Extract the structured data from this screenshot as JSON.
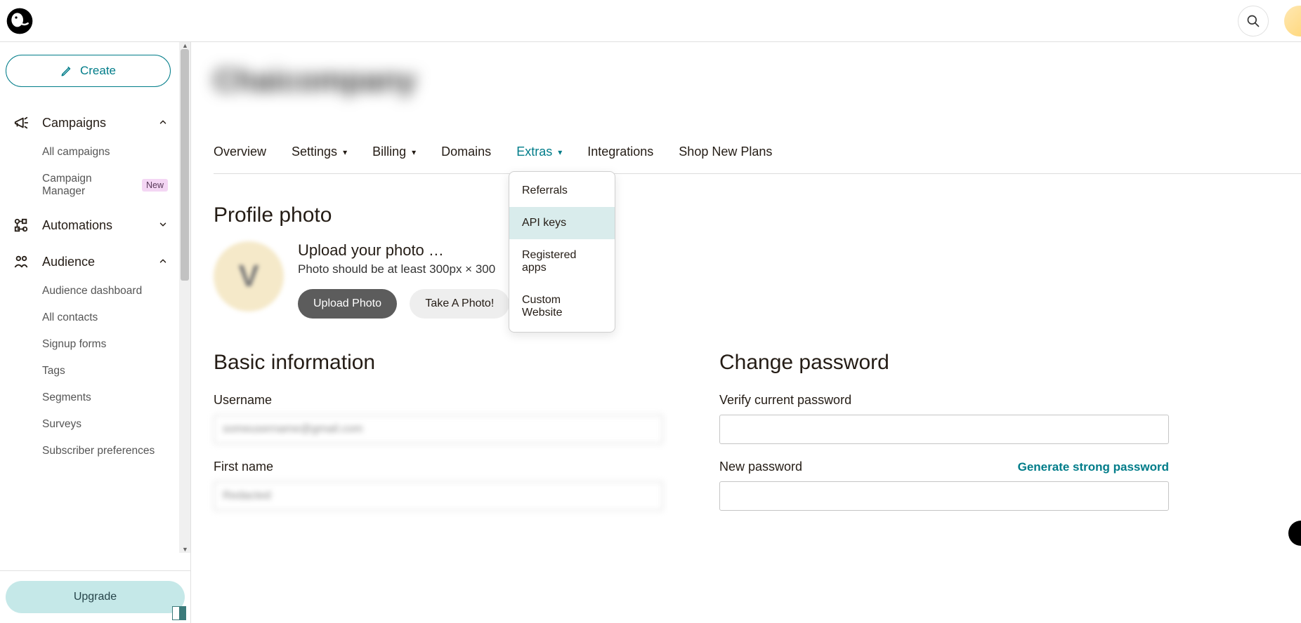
{
  "header": {
    "search_icon": "search"
  },
  "sidebar": {
    "create_label": "Create",
    "groups": [
      {
        "id": "campaigns",
        "label": "Campaigns",
        "expanded": true,
        "items": [
          {
            "label": "All campaigns"
          },
          {
            "label": "Campaign Manager",
            "badge": "New"
          }
        ]
      },
      {
        "id": "automations",
        "label": "Automations",
        "expanded": false,
        "items": []
      },
      {
        "id": "audience",
        "label": "Audience",
        "expanded": true,
        "items": [
          {
            "label": "Audience dashboard"
          },
          {
            "label": "All contacts"
          },
          {
            "label": "Signup forms"
          },
          {
            "label": "Tags"
          },
          {
            "label": "Segments"
          },
          {
            "label": "Surveys"
          },
          {
            "label": "Subscriber preferences"
          }
        ]
      }
    ],
    "upgrade_label": "Upgrade"
  },
  "page": {
    "company_title_blur": "Chaicompany",
    "tabs": {
      "overview": "Overview",
      "settings": "Settings",
      "billing": "Billing",
      "domains": "Domains",
      "extras": "Extras",
      "integrations": "Integrations",
      "shop": "Shop New Plans"
    },
    "extras_dropdown": {
      "referrals": "Referrals",
      "api_keys": "API keys",
      "registered_apps": "Registered apps",
      "custom_website": "Custom Website"
    },
    "profile_photo": {
      "heading": "Profile photo",
      "avatar_letter": "V",
      "upload_title": "Upload your photo …",
      "hint_partial": "Photo should be at least 300px × 300",
      "upload_btn": "Upload Photo",
      "take_btn": "Take A Photo!"
    },
    "basic_info": {
      "heading": "Basic information",
      "username_label": "Username",
      "username_value_blur": "someusername@gmail.com",
      "first_name_label": "First name",
      "first_name_value_blur": "Redacted"
    },
    "change_password": {
      "heading": "Change password",
      "verify_label": "Verify current password",
      "new_label": "New password",
      "generate_link": "Generate strong password"
    }
  }
}
